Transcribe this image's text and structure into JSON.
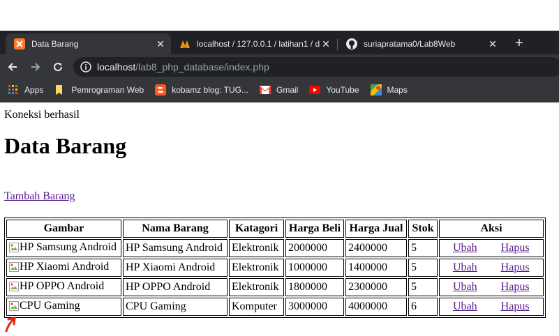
{
  "browser": {
    "tabs": [
      {
        "title": "Data Barang",
        "icon": "xampp-icon",
        "active": true
      },
      {
        "title": "localhost / 127.0.0.1 / latihan1 / d",
        "icon": "phpmyadmin-icon",
        "active": false
      },
      {
        "title": "suriapratama0/Lab8Web",
        "icon": "github-icon",
        "active": false
      }
    ],
    "url_host": "localhost",
    "url_path": "/lab8_php_database/index.php",
    "bookmarks": [
      {
        "label": "Apps",
        "icon": "apps-grid-icon"
      },
      {
        "label": "Pemrograman Web",
        "icon": "folder-icon"
      },
      {
        "label": "kobamz blog: TUG...",
        "icon": "blogger-icon"
      },
      {
        "label": "Gmail",
        "icon": "gmail-icon"
      },
      {
        "label": "YouTube",
        "icon": "youtube-icon"
      },
      {
        "label": "Maps",
        "icon": "maps-icon"
      }
    ]
  },
  "page": {
    "status": "Koneksi berhasil",
    "title": "Data Barang",
    "add_link": "Tambah Barang",
    "table": {
      "headers": [
        "Gambar",
        "Nama Barang",
        "Katagori",
        "Harga Beli",
        "Harga Jual",
        "Stok",
        "Aksi"
      ],
      "rows": [
        {
          "image_alt": "HP Samsung Android",
          "name": "HP Samsung Android",
          "category": "Elektronik",
          "buy": "2000000",
          "sell": "2400000",
          "stock": "5"
        },
        {
          "image_alt": "HP Xiaomi Android",
          "name": "HP Xiaomi Android",
          "category": "Elektronik",
          "buy": "1000000",
          "sell": "1400000",
          "stock": "5"
        },
        {
          "image_alt": "HP OPPO Android",
          "name": "HP OPPO Android",
          "category": "Elektronik",
          "buy": "1800000",
          "sell": "2300000",
          "stock": "5"
        },
        {
          "image_alt": "CPU Gaming",
          "name": "CPU Gaming",
          "category": "Komputer",
          "buy": "3000000",
          "sell": "4000000",
          "stock": "6"
        }
      ],
      "edit_label": "Ubah",
      "delete_label": "Hapus"
    }
  },
  "colors": {
    "tabstrip": "#202124",
    "toolbar": "#35363a",
    "visited_link": "#551a8b",
    "annotation_arrow": "#e0201b"
  }
}
